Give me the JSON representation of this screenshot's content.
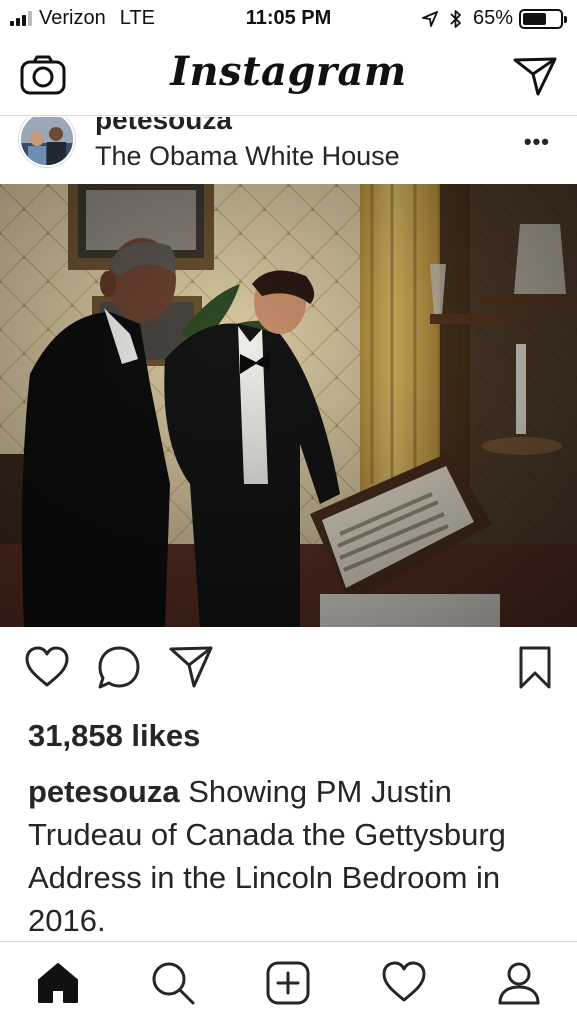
{
  "status_bar": {
    "carrier": "Verizon",
    "network": "LTE",
    "time": "11:05 PM",
    "battery_percent": "65%",
    "battery_level": 0.65,
    "signal_bars": 3,
    "icons": [
      "location-arrow-icon",
      "bluetooth-icon",
      "battery-icon"
    ]
  },
  "nav": {
    "logo": "Instagram",
    "left_icon": "camera-icon",
    "right_icon": "direct-send-icon"
  },
  "post": {
    "username": "petesouza",
    "location": "The Obama White House",
    "more_label": "•••",
    "photo_description_icon": "photo",
    "actions": [
      "heart-icon",
      "comment-icon",
      "share-icon",
      "bookmark-icon"
    ],
    "likes": "31,858 likes",
    "caption": {
      "username": "petesouza",
      "text": "Showing PM Justin Trudeau of Canada the Gettysburg Address in the Lincoln Bedroom in 2016."
    }
  },
  "tab_bar": {
    "items": [
      "home-icon",
      "search-icon",
      "add-post-icon",
      "activity-icon",
      "profile-icon"
    ],
    "active": "home-icon"
  },
  "colors": {
    "text": "#262626",
    "divider": "#dbdbdb",
    "background": "#ffffff"
  }
}
